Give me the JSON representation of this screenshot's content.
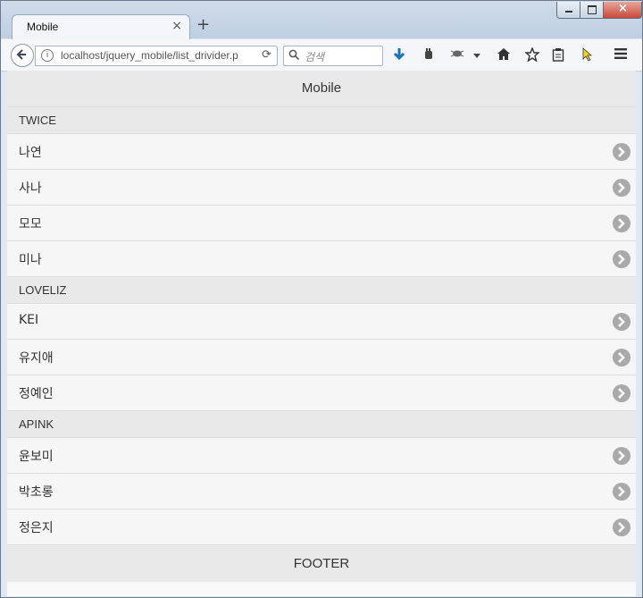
{
  "browser": {
    "tab_title": "Mobile",
    "close_glyph": "×",
    "new_tab_glyph": "+",
    "url": "localhost/jquery_mobile/list_drivider.p",
    "search_placeholder": "검색",
    "reload_glyph": "⟳"
  },
  "header": {
    "title": "Mobile"
  },
  "groups": [
    {
      "divider": "TWICE",
      "items": [
        "나연",
        "사나",
        "모모",
        "미나"
      ]
    },
    {
      "divider": "LOVELIZ",
      "items": [
        "KEI",
        "유지애",
        "정예인"
      ]
    },
    {
      "divider": "APINK",
      "items": [
        "윤보미",
        "박초롱",
        "정은지"
      ]
    }
  ],
  "footer": {
    "title": "FOOTER"
  }
}
